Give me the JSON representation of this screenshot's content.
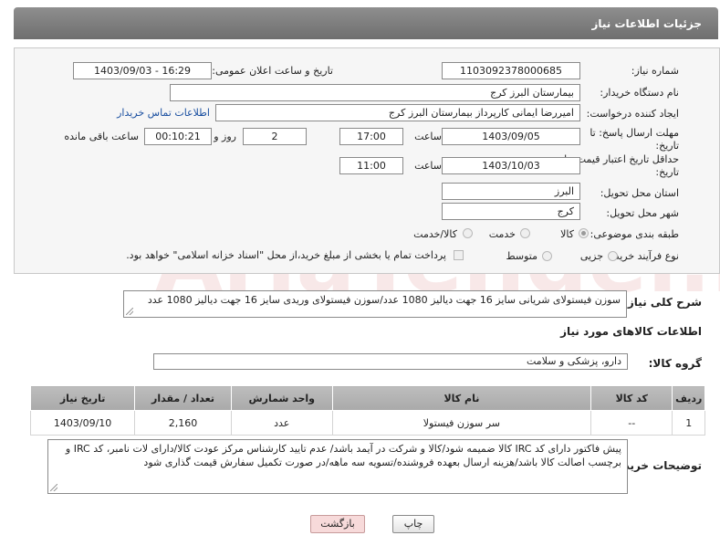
{
  "header": {
    "title": "جزئیات اطلاعات نیاز"
  },
  "form": {
    "need_number_label": "شماره نیاز:",
    "need_number": "1103092378000685",
    "announce_label": "تاریخ و ساعت اعلان عمومی:",
    "announce_value": "1403/09/03 - 16:29",
    "buyer_org_label": "نام دستگاه خریدار:",
    "buyer_org": "بیمارستان البرز کرج",
    "creator_label": "ایجاد کننده درخواست:",
    "creator": "امیررضا ایمانی کارپرداز بیمارستان البرز کرج",
    "contact_link": "اطلاعات تماس خریدار",
    "deadline_label": "مهلت ارسال پاسخ: تا تاریخ:",
    "deadline_date": "1403/09/05",
    "time_label": "ساعت",
    "deadline_time": "17:00",
    "days_value": "2",
    "days_label": "روز و",
    "remaining_time": "00:10:21",
    "remaining_label": "ساعت باقی مانده",
    "validity_label": "حداقل تاریخ اعتبار قیمت: تا تاریخ:",
    "validity_date": "1403/10/03",
    "validity_time_label": "ساعت",
    "validity_time": "11:00",
    "province_label": "استان محل تحویل:",
    "province": "البرز",
    "city_label": "شهر محل تحویل:",
    "city": "کرج",
    "category_label": "طبقه بندی موضوعی:",
    "category_options": [
      "کالا",
      "خدمت",
      "کالا/خدمت"
    ],
    "process_label": "نوع فرآیند خرید :",
    "process_options": [
      "جزیی",
      "متوسط"
    ],
    "payment_note": "پرداخت تمام یا بخشی از مبلغ خرید،از محل \"اسناد خزانه اسلامی\" خواهد بود."
  },
  "summary": {
    "label": "شرح کلی نیاز:",
    "text": "سوزن فیستولای شریانی سایز 16 جهت دیالیز 1080 عدد/سوزن فیستولای وریدی سایز 16 جهت دیالیز 1080 عدد"
  },
  "goods": {
    "section_title": "اطلاعات کالاهای مورد نیاز",
    "group_label": "گروه کالا:",
    "group_value": "دارو، پزشکی و سلامت",
    "columns": [
      "ردیف",
      "کد کالا",
      "نام کالا",
      "واحد شمارش",
      "تعداد / مقدار",
      "تاریخ نیاز"
    ],
    "rows": [
      {
        "row": "1",
        "code": "--",
        "name": "سر سوزن فیستولا",
        "unit": "عدد",
        "qty": "2,160",
        "date": "1403/09/10"
      }
    ]
  },
  "buyer_notes": {
    "label": "توضیحات خریدار:",
    "text": "پیش فاکتور دارای کد IRC کالا ضمیمه شود/کالا و شرکت در آیمد باشد/ عدم تایید کارشناس مرکز عودت کالا/دارای لات نامبر، کد IRC و برچسب اصالت کالا باشد/هزینه ارسال بعهده فروشنده/تسویه سه ماهه/در صورت تکمیل سفارش قیمت گذاری شود"
  },
  "buttons": {
    "print": "چاپ",
    "back": "بازگشت"
  },
  "watermark": "AriaTender.neT",
  "colors": {
    "header": "#7f7f7f",
    "link": "#1a4fa0",
    "back_button": "#f7dada"
  }
}
